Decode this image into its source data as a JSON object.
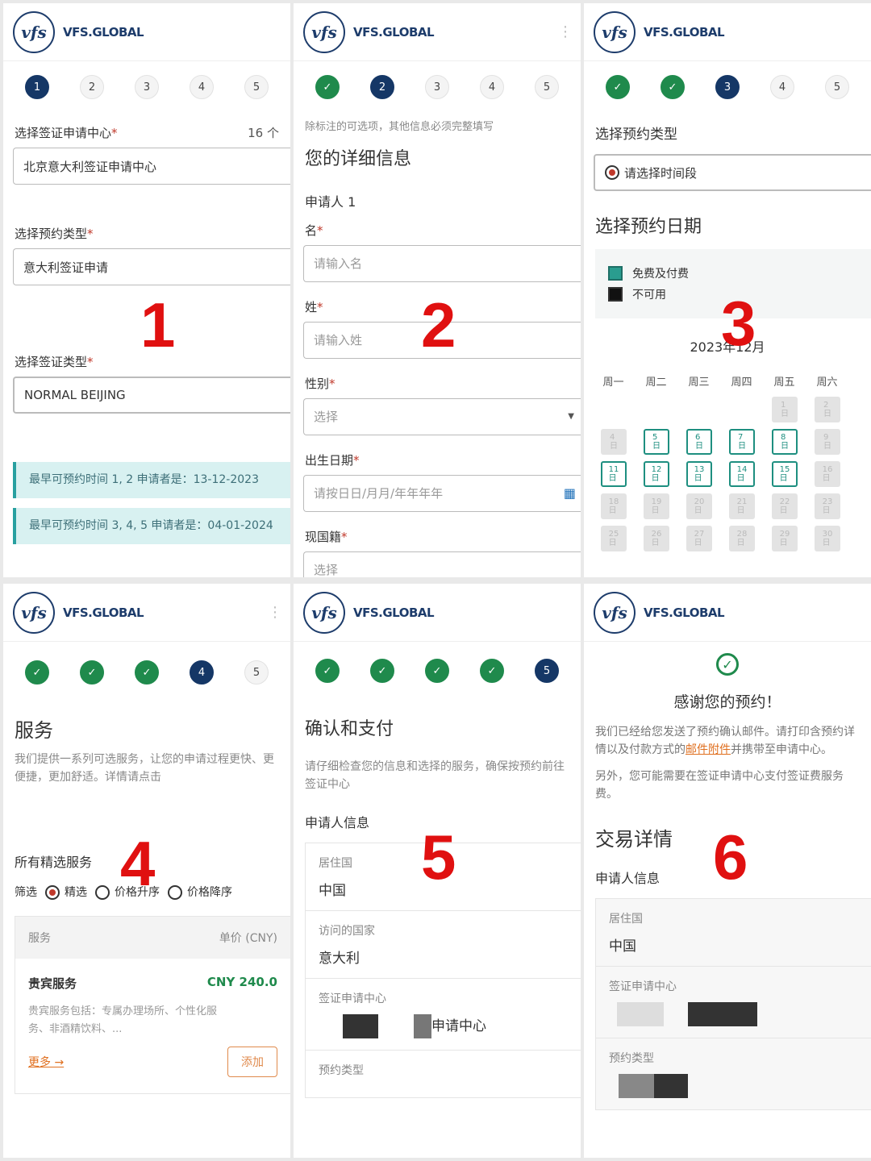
{
  "brand": "VFS.GLOBAL",
  "logo_text": "vfs",
  "p1": {
    "steps": [
      "1",
      "2",
      "3",
      "4",
      "5"
    ],
    "center_label": "选择签证申请中心",
    "center_count": "16 个",
    "center_value": "北京意大利签证申请中心",
    "appt_label": "选择预约类型",
    "appt_value": "意大利签证申请",
    "visa_label": "选择签证类型",
    "visa_value": "NORMAL BEIJING",
    "info1": "最早可预约时间 1, 2 申请者是：13-12-2023",
    "info2": "最早可预约时间 3, 4, 5 申请者是：04-01-2024",
    "big": "1"
  },
  "p2": {
    "note": "除标注的可选项，其他信息必须完整填写",
    "title": "您的详细信息",
    "applicant": "申请人 1",
    "first_label": "名",
    "first_ph": "请输入名",
    "last_label": "姓",
    "last_ph": "请输入姓",
    "gender_label": "性别",
    "gender_ph": "选择",
    "dob_label": "出生日期",
    "dob_ph": "请按日日/月月/年年年年",
    "nat_label": "现国籍",
    "nat_ph": "选择",
    "big": "2"
  },
  "p3": {
    "appt_title": "选择预约类型",
    "slot_label": "请选择时间段",
    "date_title": "选择预约日期",
    "legend_free": "免费及付费",
    "legend_na": "不可用",
    "month": "2023年12月",
    "weekdays": [
      "周一",
      "周二",
      "周三",
      "周四",
      "周五",
      "周六"
    ],
    "big": "3"
  },
  "p4": {
    "title": "服务",
    "desc": "我们提供一系列可选服务，让您的申请过程更快、更便捷，更加舒适。详情请点击",
    "all_label": "所有精选服务",
    "filter_label": "筛选",
    "opt1": "精选",
    "opt2": "价格升序",
    "opt3": "价格降序",
    "col_service": "服务",
    "col_price": "单价 (CNY)",
    "svc_name": "贵宾服务",
    "svc_price": "CNY 240.0",
    "svc_desc": "贵宾服务包括：专属办理场所、个性化服务、非酒精饮料、...",
    "more": "更多 →",
    "add": "添加",
    "big": "4"
  },
  "p5": {
    "title": "确认和支付",
    "desc": "请仔细检查您的信息和选择的服务，确保按预约前往签证中心",
    "section": "申请人信息",
    "k1": "居住国",
    "v1": "中国",
    "k2": "访问的国家",
    "v2": "意大利",
    "k3": "签证申请中心",
    "v3": "申请中心",
    "k4": "预约类型",
    "big": "5"
  },
  "p6": {
    "thanks": "感谢您的预约！",
    "msg1a": "我们已经给您发送了预约确认邮件。请打印含预约详情以及付款方式的",
    "msg1link": "邮件附件",
    "msg1b": "并携带至申请中心。",
    "msg2": "另外，您可能需要在签证申请中心支付签证费服务费。",
    "tx_title": "交易详情",
    "section": "申请人信息",
    "k1": "居住国",
    "v1": "中国",
    "k2": "签证申请中心",
    "k3": "预约类型",
    "big": "6"
  },
  "colors": {
    "brand": "#1d3c6b",
    "done": "#1f8a4c",
    "red_num": "#e01010",
    "info_bg": "#d8f1f1"
  },
  "icons": [
    "vfs-logo-icon",
    "menu-icon",
    "check-icon",
    "calendar-icon",
    "dropdown-icon"
  ]
}
